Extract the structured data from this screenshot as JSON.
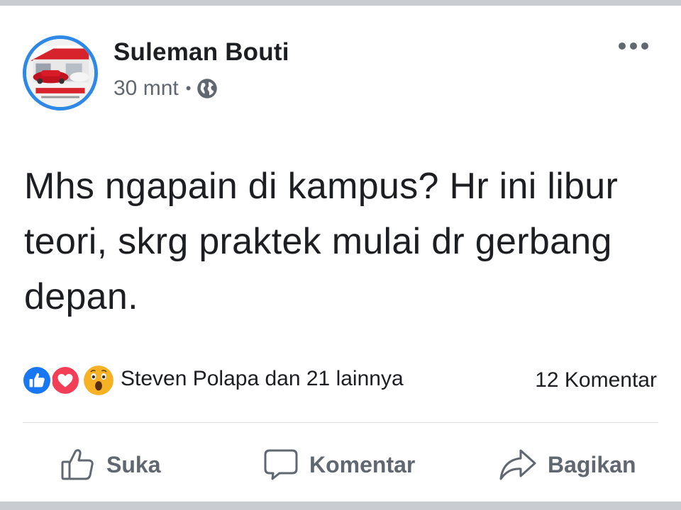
{
  "post": {
    "author": "Suleman Bouti",
    "time": "30 mnt",
    "separator": "•",
    "privacy_icon": "globe-icon",
    "text": "Mhs ngapain di kampus? Hr ini libur teori, skrg praktek mulai dr gerbang depan."
  },
  "reactions": {
    "icons": [
      "like-icon",
      "love-icon",
      "wow-icon"
    ],
    "summary": "Steven Polapa dan 21 lainnya",
    "comments": "12 Komentar"
  },
  "actions": {
    "like_label": "Suka",
    "comment_label": "Komentar",
    "share_label": "Bagikan"
  },
  "colors": {
    "accent": "#2d88e6",
    "like": "#1877f2",
    "love": "#f33e58",
    "wow": "#f7b125",
    "muted_text": "#606770",
    "frame": "#c9ccd1"
  }
}
